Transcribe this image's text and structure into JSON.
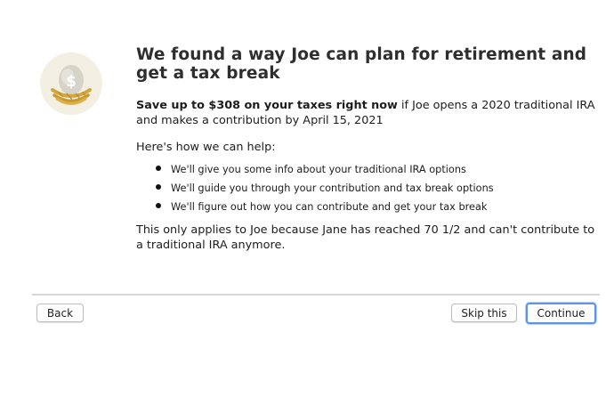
{
  "icon": {
    "name": "nest-egg-dollar-icon",
    "badge_color": "#f3efe3",
    "egg_color": "#d9d6cc",
    "nest_color": "#d3a63a"
  },
  "heading": {
    "title": "We found a way Joe can plan for retirement and get a tax break"
  },
  "lead": {
    "bold": "Save up to $308 on your taxes right now",
    "rest": " if Joe opens a 2020 traditional IRA and makes a contribution by April 15, 2021"
  },
  "help_intro": "Here's how we can help:",
  "bullets": [
    "We'll give you some info about your traditional IRA options",
    "We'll guide you through your contribution and tax break options",
    "We'll figure out how you can contribute and get your tax break"
  ],
  "note": "This only applies to Joe because Jane has reached 70 1/2 and can't contribute to a traditional IRA anymore.",
  "buttons": {
    "back": "Back",
    "skip": "Skip this",
    "continue": "Continue"
  },
  "colors": {
    "focus_ring": "#5d94e8"
  }
}
